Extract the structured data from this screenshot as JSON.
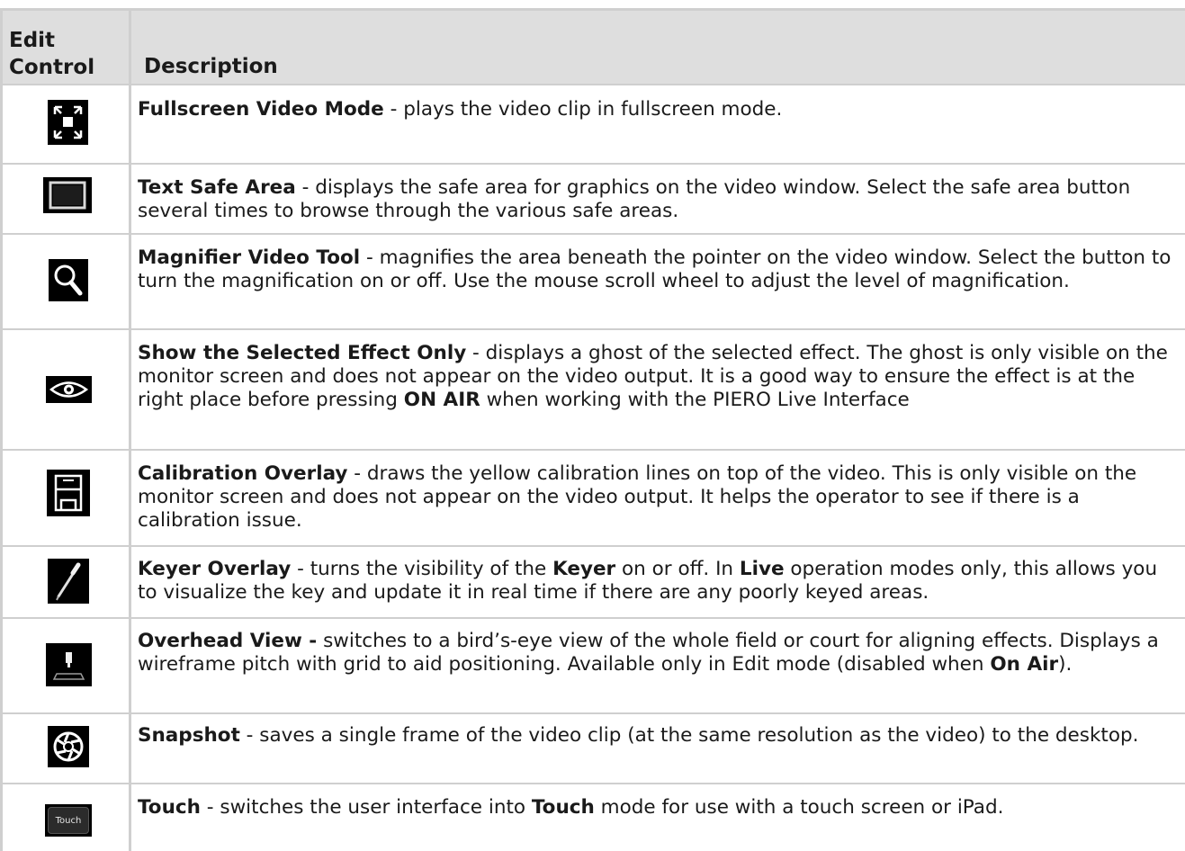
{
  "header": {
    "col1": "Edit Control",
    "col1_line1": "Edit",
    "col1_line2": "Control",
    "col2": "Description"
  },
  "rows": [
    {
      "icon": "fullscreen-icon",
      "title": "Fullscreen Video Mode",
      "text": " - plays the video clip in fullscreen mode."
    },
    {
      "icon": "safe-area-icon",
      "title": "Text Safe Area",
      "text": " - displays the safe area for graphics on the video window. Select the safe area button several times to browse through the various safe areas."
    },
    {
      "icon": "magnifier-icon",
      "title": "Magnifier Video Tool",
      "text": " - magnifies the area beneath the pointer on the video window. Select the button to turn the magnification on or off. Use the mouse scroll wheel to adjust the level of magnification."
    },
    {
      "icon": "eye-icon",
      "title": "Show the Selected Effect Only",
      "text_a": " - displays a ghost of the selected effect. The ghost is only visible on the monitor screen and does not appear on the video output. It is a good way to ensure the effect is at the right place before pressing ",
      "bold_b": "ON AIR",
      "text_c": " when working with the PIERO Live Interface"
    },
    {
      "icon": "calibration-icon",
      "title": "Calibration Overlay",
      "text": " - draws the yellow calibration lines on top of the video. This is only visible on the monitor screen and does not appear on the video output. It helps the operator to see if there is a calibration issue."
    },
    {
      "icon": "dropper-icon",
      "title": "Keyer Overlay",
      "text_a": " - turns the visibility of the ",
      "bold_b": "Keyer",
      "text_c": " on or off. In ",
      "bold_d": "Live",
      "text_e": " operation modes only, this allows you to visualize the key and update it in real time if there are any poorly keyed areas."
    },
    {
      "icon": "overhead-view-icon",
      "title": "Overhead View -",
      "text_a": " switches to a bird’s-eye view of the whole field or court for aligning effects. Displays a wireframe pitch with grid to aid positioning. Available only in Edit mode (disabled when ",
      "bold_b": "On Air",
      "text_c": ")."
    },
    {
      "icon": "camera-shutter-icon",
      "title": "Snapshot",
      "text": " - saves a single frame of the video clip (at the same resolution as the video) to the desktop."
    },
    {
      "icon": "touch-icon",
      "icon_label": "Touch",
      "title": "Touch",
      "text_a": " - switches the user interface into ",
      "bold_b": "Touch",
      "text_c": " mode for use with a touch screen or iPad."
    }
  ]
}
